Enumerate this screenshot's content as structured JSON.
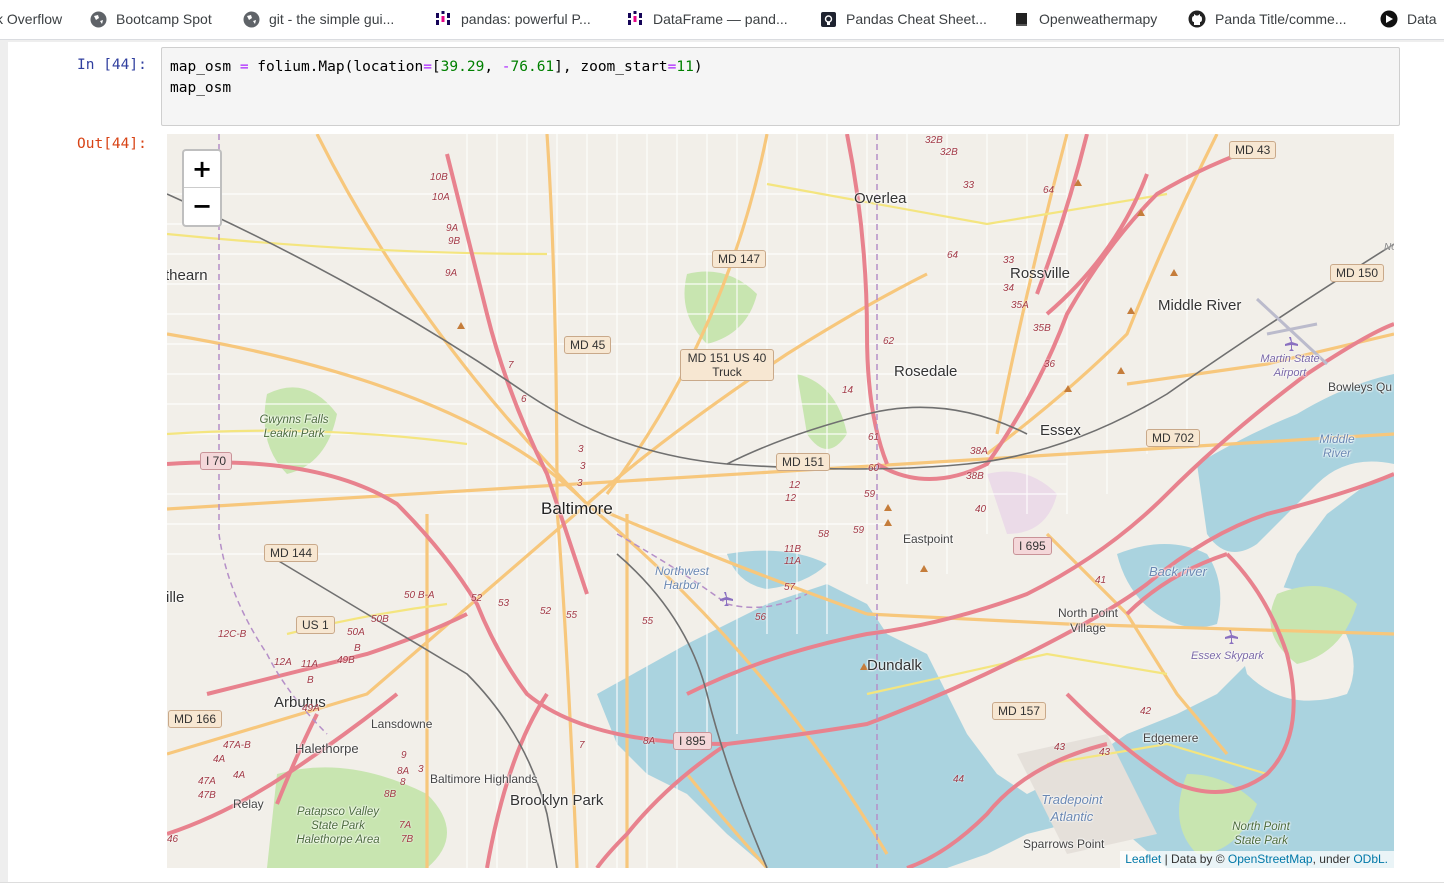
{
  "bookmarks": [
    {
      "label": "k Overflow",
      "icon": "stackoverflow-icon"
    },
    {
      "label": "Bootcamp Spot",
      "icon": "globe-icon"
    },
    {
      "label": "git - the simple gui...",
      "icon": "globe-icon"
    },
    {
      "label": "pandas: powerful P...",
      "icon": "pandas-icon"
    },
    {
      "label": "DataFrame — pand...",
      "icon": "pandas-icon"
    },
    {
      "label": "Pandas Cheat Sheet...",
      "icon": "cheatsheet-icon"
    },
    {
      "label": "Openweathermapy",
      "icon": "book-icon"
    },
    {
      "label": "Panda Title/comme...",
      "icon": "github-icon"
    },
    {
      "label": "Data",
      "icon": "data-icon"
    }
  ],
  "cell": {
    "in_prompt": "In [44]:",
    "out_prompt": "Out[44]:",
    "code_line1": {
      "a": "map_osm ",
      "eq": "=",
      "b": " folium.Map(location",
      "eq2": "=",
      "c": "[",
      "n1": "39.29",
      "d": ", ",
      "minus": "-",
      "n2": "76.61",
      "e": "], zoom_start",
      "eq3": "=",
      "n3": "11",
      "f": ")"
    },
    "code_line2": "map_osm"
  },
  "map": {
    "zoom_in": "+",
    "zoom_out": "−",
    "attribution": {
      "leaflet": "Leaflet",
      "sep": " | Data by © ",
      "osm": "OpenStreetMap",
      "under": ", under ",
      "odbl": "ODbL."
    },
    "places": [
      {
        "name": "Baltimore",
        "kind": "city"
      },
      {
        "name": "Overlea",
        "kind": "town"
      },
      {
        "name": "Rossville",
        "kind": "town"
      },
      {
        "name": "Middle River",
        "kind": "town"
      },
      {
        "name": "Rosedale",
        "kind": "town"
      },
      {
        "name": "Essex",
        "kind": "town"
      },
      {
        "name": "Dundalk",
        "kind": "town"
      },
      {
        "name": "Arbutus",
        "kind": "town"
      },
      {
        "name": "Halethorpe",
        "kind": "small"
      },
      {
        "name": "Lansdowne",
        "kind": "small"
      },
      {
        "name": "Baltimore Highlands",
        "kind": "small"
      },
      {
        "name": "Brooklyn Park",
        "kind": "town"
      },
      {
        "name": "Eastpoint",
        "kind": "small"
      },
      {
        "name": "North Point Village",
        "kind": "small"
      },
      {
        "name": "Edgemere",
        "kind": "small"
      },
      {
        "name": "Sparrows Point",
        "kind": "small"
      },
      {
        "name": "Relay",
        "kind": "small"
      },
      {
        "name": "Bowleys Qu",
        "kind": "small"
      },
      {
        "name": "thearn",
        "kind": "town"
      },
      {
        "name": "ille",
        "kind": "town"
      },
      {
        "name": "Gwynns Falls Leakin Park",
        "kind": "park"
      },
      {
        "name": "Patapsco Valley State Park Halethorpe Area",
        "kind": "park"
      },
      {
        "name": "North Point State Park",
        "kind": "park"
      },
      {
        "name": "Martin State Airport",
        "kind": "air"
      },
      {
        "name": "Essex Skypark",
        "kind": "air"
      },
      {
        "name": "Northwest Harbor",
        "kind": "water"
      },
      {
        "name": "Middle River",
        "kind": "water"
      },
      {
        "name": "Back river",
        "kind": "water"
      },
      {
        "name": "Tradepoint Atlantic",
        "kind": "water"
      }
    ],
    "shields": [
      "MD 43",
      "MD 147",
      "MD 150",
      "MD 45",
      "MD 151 US 40 Truck",
      "MD 702",
      "I 70",
      "MD 151",
      "I 695",
      "MD 144",
      "US 1",
      "MD 166",
      "MD 157",
      "I 895"
    ],
    "exits": [
      "32B",
      "32B",
      "33",
      "64",
      "64",
      "33",
      "34",
      "35A",
      "35B",
      "36",
      "62",
      "10B",
      "10A",
      "9A",
      "9B",
      "9A",
      "6",
      "7",
      "3",
      "3",
      "3",
      "14",
      "61",
      "60",
      "59",
      "59",
      "58",
      "38A",
      "38B",
      "40",
      "12",
      "12",
      "11B",
      "11A",
      "57",
      "56",
      "50 B-A",
      "52",
      "53",
      "52",
      "55",
      "55",
      "50A",
      "50B",
      "B",
      "49B",
      "12C-B",
      "12A",
      "11A",
      "B",
      "49A",
      "41",
      "42",
      "43",
      "43",
      "44",
      "47A-B",
      "4A",
      "4A",
      "47A",
      "47B",
      "9",
      "8A",
      "3",
      "8B",
      "7A",
      "7B",
      "8",
      "7",
      "8A",
      "46",
      "No"
    ]
  }
}
